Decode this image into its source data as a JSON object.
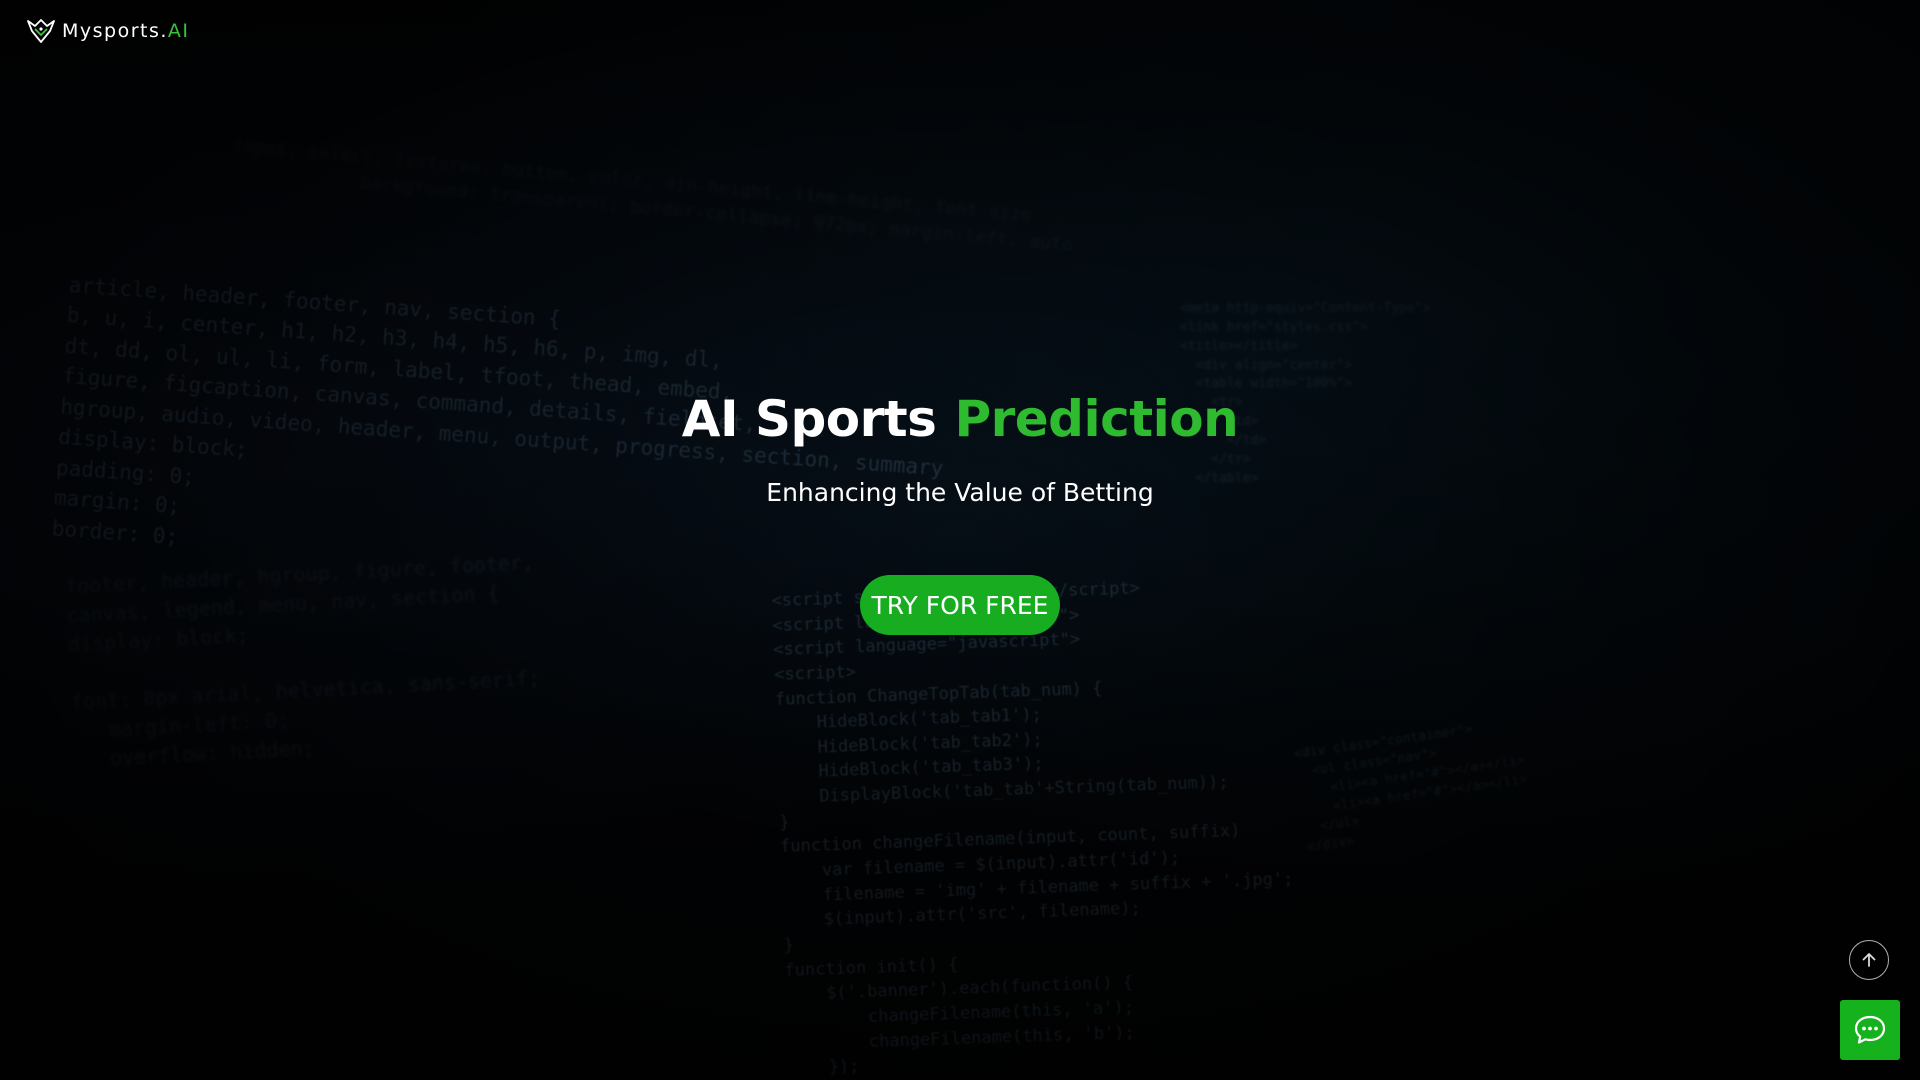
{
  "brand": {
    "name_main": "Mysports.",
    "name_accent": "AI",
    "logo_icon": "eagle-head-icon",
    "accent_color": "#2fbb2f"
  },
  "hero": {
    "title_main": "AI Sports",
    "title_accent": "Prediction",
    "subtitle": "Enhancing the Value of Betting",
    "cta_label": "TRY FOR FREE",
    "cta_color": "#18ad21"
  },
  "controls": {
    "scroll_top_icon": "arrow-up-icon",
    "chat_icon": "chat-bubble-icon",
    "chat_color": "#16b21d"
  }
}
